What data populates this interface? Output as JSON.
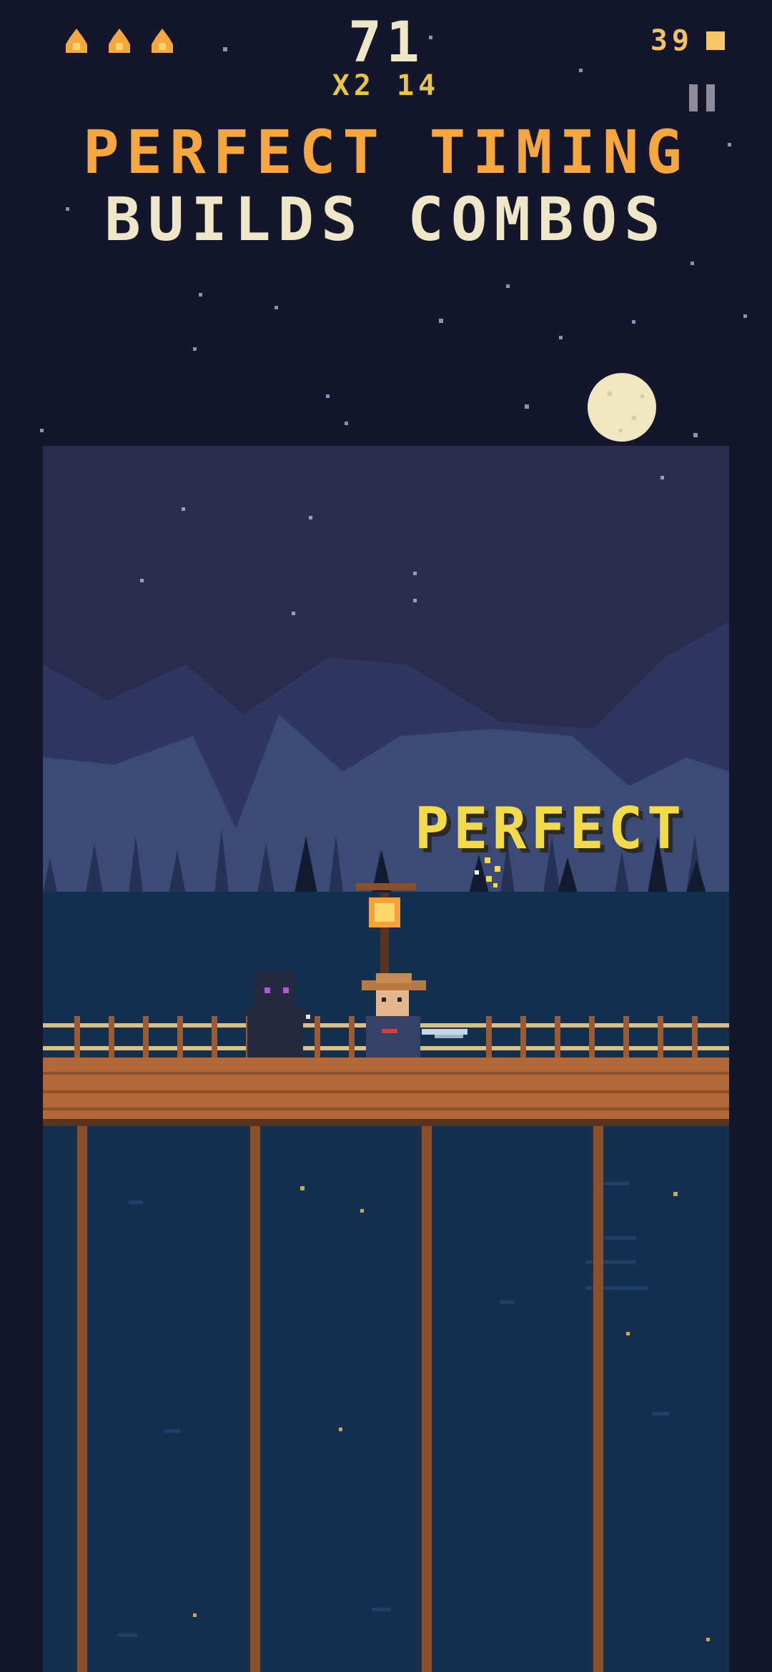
{
  "hud": {
    "score": "71",
    "combo": "x2 14",
    "coins": "39",
    "lives": 3,
    "pause_icon": "pause-icon",
    "life_icon": "flame-icon",
    "coin_icon": "coin-icon"
  },
  "tutorial": {
    "line1": "PERFECT TIMING",
    "line2": "BUILDS COMBOS"
  },
  "feedback": {
    "label": "PERFECT"
  },
  "colors": {
    "sky": "#14162b",
    "scene_sky": "#2b2b4d",
    "mountain_far": "#313a64",
    "mountain_near": "#3a4a74",
    "water": "#15304f",
    "bridge": "#b3683a",
    "accent_orange": "#f6a63f",
    "accent_yellow": "#f3da4a",
    "text_cream": "#efe6c8"
  }
}
